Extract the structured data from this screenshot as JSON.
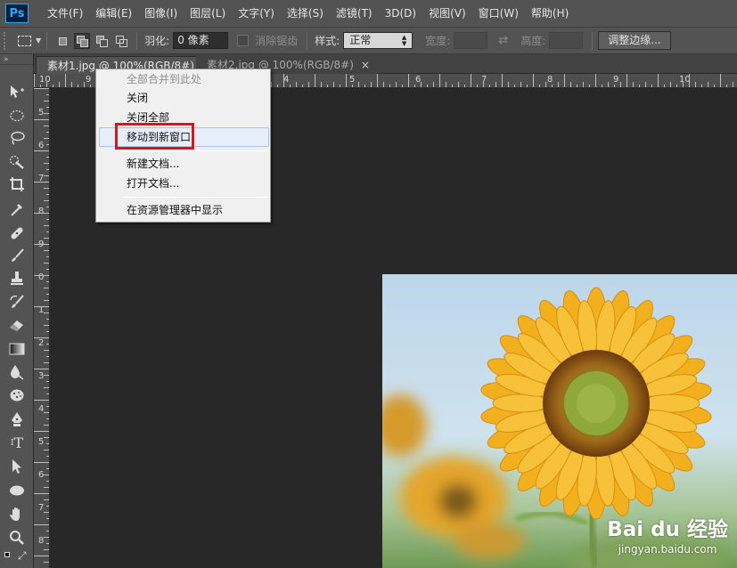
{
  "app": {
    "logo": "Ps",
    "menus": [
      "文件(F)",
      "编辑(E)",
      "图像(I)",
      "图层(L)",
      "文字(Y)",
      "选择(S)",
      "滤镜(T)",
      "3D(D)",
      "视图(V)",
      "窗口(W)",
      "帮助(H)"
    ]
  },
  "options": {
    "feather_label": "羽化:",
    "feather_value": "0 像素",
    "antialias_label": "消除锯齿",
    "style_label": "样式:",
    "style_value": "正常",
    "width_label": "宽度:",
    "height_label": "高度:",
    "refine_button": "调整边缘..."
  },
  "tabs": [
    {
      "title": "素材1.jpg @ 100%(RGB/8#)",
      "active": true,
      "close": "×"
    },
    {
      "title": "素材2.jpg @ 100%(RGB/8#)",
      "active": false,
      "close": "×"
    }
  ],
  "rulers": {
    "top_labels": [
      "10",
      "9",
      "2",
      "3",
      "4",
      "5",
      "6",
      "7",
      "8",
      "9",
      "10"
    ],
    "left_labels": [
      "5",
      "6",
      "7",
      "8",
      "9",
      "0",
      "1",
      "2",
      "3",
      "4",
      "5",
      "6",
      "7",
      "8"
    ]
  },
  "context_menu": {
    "items": [
      {
        "label": "全部合并到此处",
        "disabled": true
      },
      {
        "label": "关闭"
      },
      {
        "label": "关闭全部"
      },
      {
        "label": "移动到新窗口",
        "highlighted": true
      },
      {
        "label": "新建文档..."
      },
      {
        "label": "打开文档..."
      },
      {
        "label": "在资源管理器中显示"
      }
    ]
  },
  "watermark": {
    "logo": "Bai du 经验",
    "url": "jingyan.baidu.com"
  },
  "colors": {
    "ui_dark": "#535353",
    "canvas_bg": "#282828",
    "ps_blue": "#31a8ff",
    "highlight_box": "#d3171d",
    "menu_hover": "#e5eef9"
  }
}
